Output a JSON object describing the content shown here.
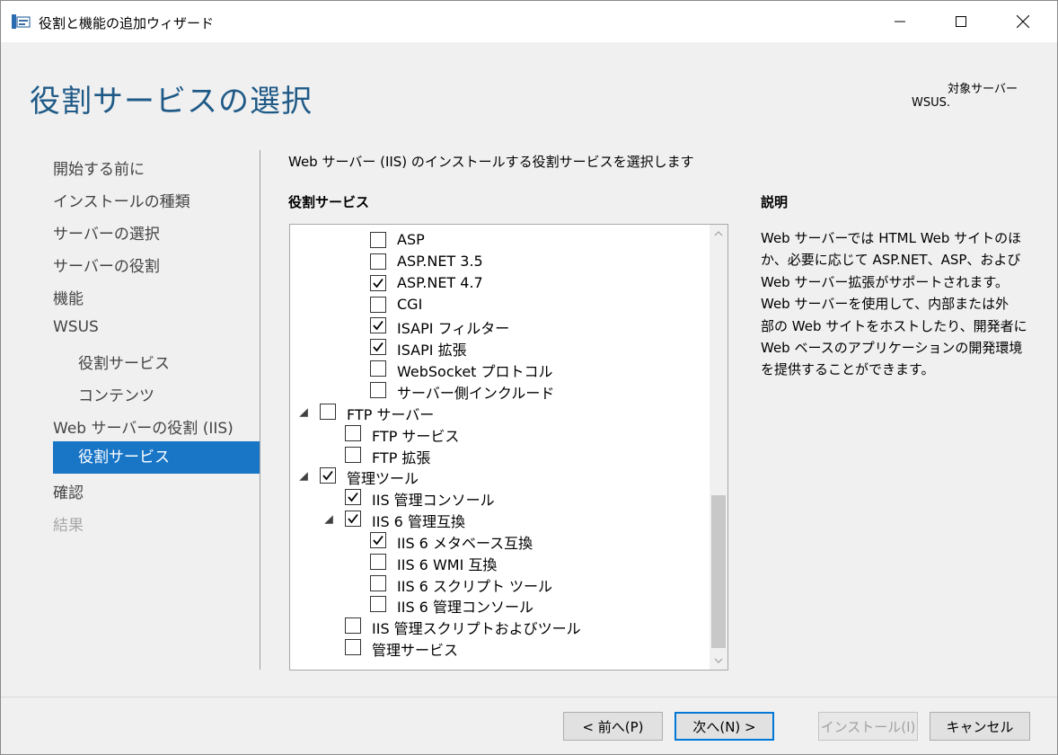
{
  "window": {
    "title": "役割と機能の追加ウィザード"
  },
  "header": {
    "title": "役割サービスの選択",
    "target_label": "対象サーバー",
    "target_value": "WSUS."
  },
  "nav": {
    "items": [
      {
        "label": "開始する前に",
        "state": "normal"
      },
      {
        "label": "インストールの種類",
        "state": "normal"
      },
      {
        "label": "サーバーの選択",
        "state": "normal"
      },
      {
        "label": "サーバーの役割",
        "state": "normal"
      },
      {
        "label": "機能",
        "state": "normal"
      },
      {
        "label": "WSUS",
        "state": "normal"
      },
      {
        "label": "役割サービス",
        "state": "normal"
      },
      {
        "label": "コンテンツ",
        "state": "normal"
      },
      {
        "label": "Web サーバーの役割 (IIS)",
        "state": "normal"
      },
      {
        "label": "役割サービス",
        "state": "active"
      },
      {
        "label": "確認",
        "state": "normal"
      },
      {
        "label": "結果",
        "state": "disabled"
      }
    ]
  },
  "main": {
    "instruction": "Web サーバー (IIS) のインストールする役割サービスを選択します",
    "services_label": "役割サービス",
    "description_label": "説明",
    "description_lines": [
      "Web サーバーでは HTML Web サイトのほ",
      "か、必要に応じて ASP.NET、ASP、および",
      "Web サーバー拡張がサポートされます。",
      "Web サーバーを使用して、内部または外",
      "部の Web サイトをホストしたり、開発者に",
      "Web ベースのアプリケーションの開発環境",
      "を提供することができます。"
    ]
  },
  "tree": {
    "rows": [
      {
        "label": "ASP",
        "checked": false,
        "expanded": null
      },
      {
        "label": "ASP.NET 3.5",
        "checked": false,
        "expanded": null
      },
      {
        "label": "ASP.NET 4.7",
        "checked": true,
        "expanded": null
      },
      {
        "label": "CGI",
        "checked": false,
        "expanded": null
      },
      {
        "label": "ISAPI フィルター",
        "checked": true,
        "expanded": null
      },
      {
        "label": "ISAPI 拡張",
        "checked": true,
        "expanded": null
      },
      {
        "label": "WebSocket プロトコル",
        "checked": false,
        "expanded": null
      },
      {
        "label": "サーバー側インクルード",
        "checked": false,
        "expanded": null
      },
      {
        "label": "FTP サーバー",
        "checked": false,
        "expanded": true
      },
      {
        "label": "FTP サービス",
        "checked": false,
        "expanded": null
      },
      {
        "label": "FTP 拡張",
        "checked": false,
        "expanded": null
      },
      {
        "label": "管理ツール",
        "checked": true,
        "expanded": true
      },
      {
        "label": "IIS 管理コンソール",
        "checked": true,
        "expanded": null
      },
      {
        "label": "IIS 6 管理互換",
        "checked": true,
        "expanded": true
      },
      {
        "label": "IIS 6 メタベース互換",
        "checked": true,
        "expanded": null
      },
      {
        "label": "IIS 6 WMI 互換",
        "checked": false,
        "expanded": null
      },
      {
        "label": "IIS 6 スクリプト ツール",
        "checked": false,
        "expanded": null
      },
      {
        "label": "IIS 6 管理コンソール",
        "checked": false,
        "expanded": null
      },
      {
        "label": "IIS 管理スクリプトおよびツール",
        "checked": false,
        "expanded": null
      },
      {
        "label": "管理サービス",
        "checked": false,
        "expanded": null
      }
    ]
  },
  "footer": {
    "prev": "< 前へ(P)",
    "next": "次へ(N) >",
    "install": "インストール(I)",
    "cancel": "キャンセル"
  },
  "icons": {
    "app": "server-manager-icon",
    "minimize": "minimize-icon",
    "maximize": "maximize-icon",
    "close": "close-icon",
    "check": "check-icon",
    "expand": "expanded-triangle-icon",
    "scroll_up": "chevron-up-icon",
    "scroll_down": "chevron-down-icon"
  },
  "colors": {
    "accent": "#1976c7",
    "header_title": "#1f5a87",
    "disabled_text": "#a8a8a8"
  }
}
